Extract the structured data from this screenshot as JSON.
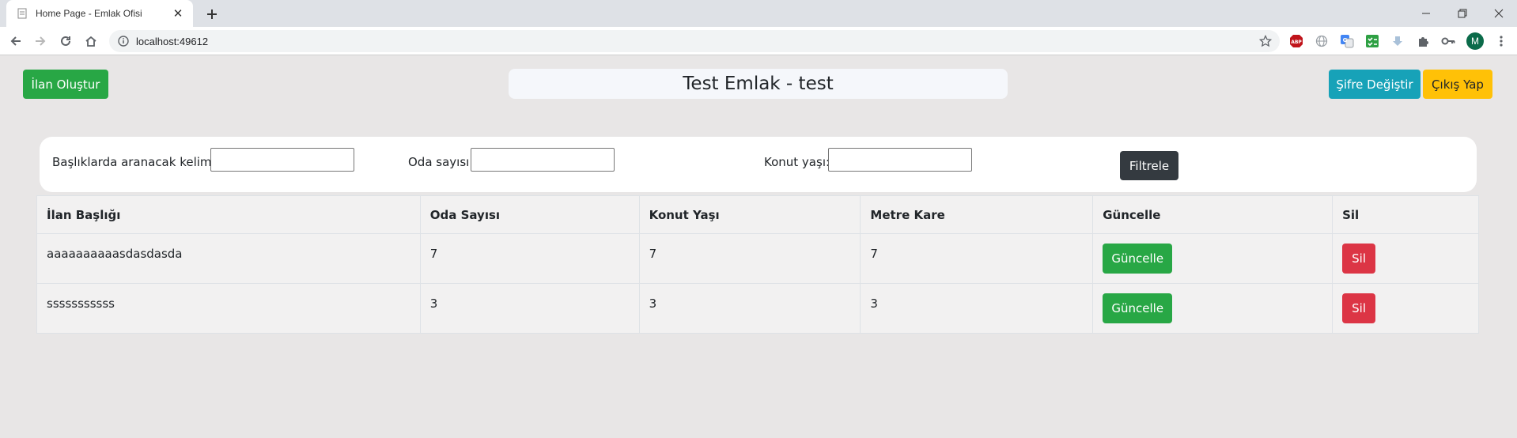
{
  "browser": {
    "tab_title": "Home Page - Emlak Ofisi",
    "url": "localhost:49612",
    "profile_initial": "M"
  },
  "header": {
    "create_button": "İlan Oluştur",
    "title": "Test Emlak - test",
    "change_password_button": "Şifre Değiştir",
    "logout_button": "Çıkış Yap"
  },
  "filter": {
    "keyword_label": "Başlıklarda aranacak kelime:",
    "keyword_value": "",
    "rooms_label": "Oda sayısı:",
    "rooms_value": "",
    "age_label": "Konut yaşı:",
    "age_value": "",
    "filter_button": "Filtrele"
  },
  "table": {
    "headers": [
      "İlan Başlığı",
      "Oda Sayısı",
      "Konut Yaşı",
      "Metre Kare",
      "Güncelle",
      "Sil"
    ],
    "rows": [
      {
        "title": "aaaaaaaaaasdasdasda",
        "rooms": "7",
        "age": "7",
        "area": "7",
        "update_label": "Güncelle",
        "delete_label": "Sil"
      },
      {
        "title": "sssssssssss",
        "rooms": "3",
        "age": "3",
        "area": "3",
        "update_label": "Güncelle",
        "delete_label": "Sil"
      }
    ]
  },
  "colors": {
    "success": "#28a745",
    "info": "#17a2b8",
    "warning": "#ffc107",
    "danger": "#dc3545",
    "dark": "#343a40"
  }
}
